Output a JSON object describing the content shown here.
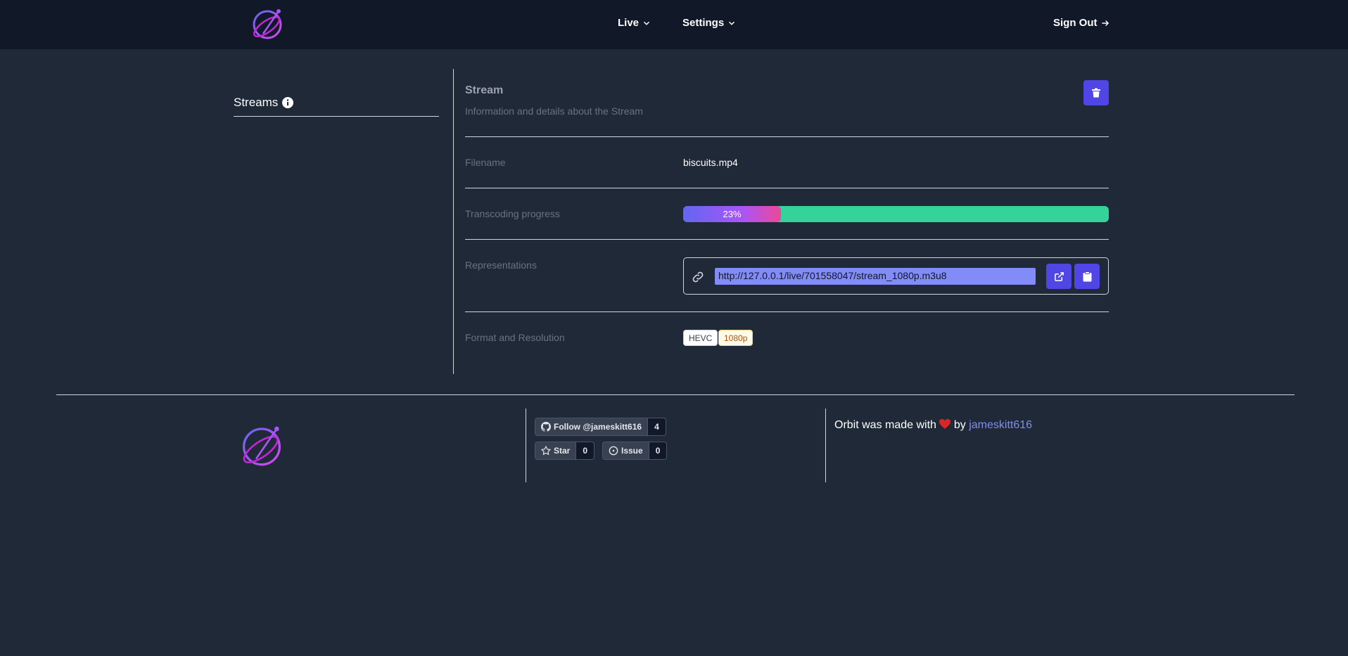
{
  "header": {
    "nav": [
      {
        "label": "Live"
      },
      {
        "label": "Settings"
      }
    ],
    "sign_out": "Sign Out"
  },
  "sidebar": {
    "title": "Streams"
  },
  "stream": {
    "title": "Stream",
    "subtitle": "Information and details about the Stream",
    "rows": {
      "filename_label": "Filename",
      "filename_value": "biscuits.mp4",
      "progress_label": "Transcoding progress",
      "progress_text": "23%",
      "progress_percent": 23,
      "representations_label": "Representations",
      "representation_url": "http://127.0.0.1/live/701558047/stream_1080p.m3u8",
      "format_label": "Format and Resolution",
      "format": "HEVC",
      "resolution": "1080p"
    }
  },
  "footer": {
    "follow_label": "Follow @jameskitt616",
    "follow_count": "4",
    "star_label": "Star",
    "star_count": "0",
    "issue_label": "Issue",
    "issue_count": "0",
    "credit_prefix": "Orbit was made with",
    "credit_by": "by",
    "credit_author": "jameskitt616"
  },
  "colors": {
    "accent": "#4f46e5",
    "progress_done": "#6366f1",
    "progress_remaining": "#34d399",
    "link": "#818cf8"
  },
  "icons": [
    "orbit-logo-icon",
    "chevron-down-icon",
    "arrow-right-icon",
    "info-icon",
    "trash-icon",
    "link-icon",
    "external-link-icon",
    "clipboard-icon",
    "github-icon",
    "star-icon",
    "issue-icon",
    "heart-icon"
  ]
}
